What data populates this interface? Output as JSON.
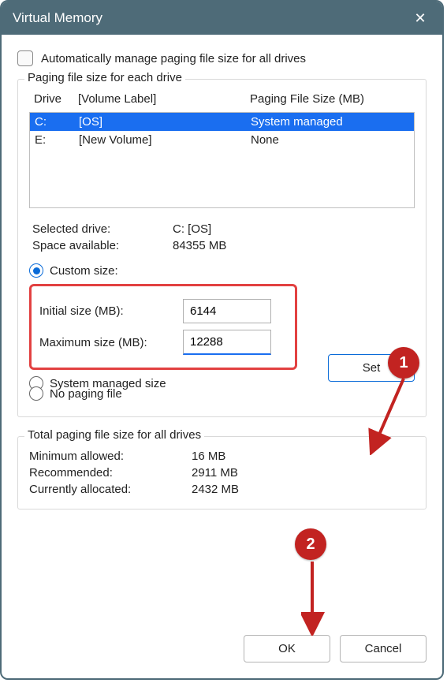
{
  "title": "Virtual Memory",
  "auto_manage_label": "Automatically manage paging file size for all drives",
  "group1_legend": "Paging file size for each drive",
  "headers": {
    "drive": "Drive",
    "vol": "[Volume Label]",
    "size": "Paging File Size (MB)"
  },
  "drives": [
    {
      "drive": "C:",
      "vol": "[OS]",
      "size": "System managed",
      "selected": true
    },
    {
      "drive": "E:",
      "vol": "[New Volume]",
      "size": "None",
      "selected": false
    }
  ],
  "selected": {
    "drive_label": "Selected drive:",
    "drive_value": "C:  [OS]",
    "space_label": "Space available:",
    "space_value": "84355 MB"
  },
  "radios": {
    "custom": "Custom size:",
    "system": "System managed size",
    "none": "No paging file"
  },
  "sizes": {
    "initial_label": "Initial size (MB):",
    "initial_value": "6144",
    "max_label": "Maximum size (MB):",
    "max_value": "12288"
  },
  "set_label": "Set",
  "group2_legend": "Total paging file size for all drives",
  "totals": {
    "min_label": "Minimum allowed:",
    "min_value": "16 MB",
    "rec_label": "Recommended:",
    "rec_value": "2911 MB",
    "cur_label": "Currently allocated:",
    "cur_value": "2432 MB"
  },
  "ok_label": "OK",
  "cancel_label": "Cancel",
  "annotations": {
    "a1": "1",
    "a2": "2"
  }
}
